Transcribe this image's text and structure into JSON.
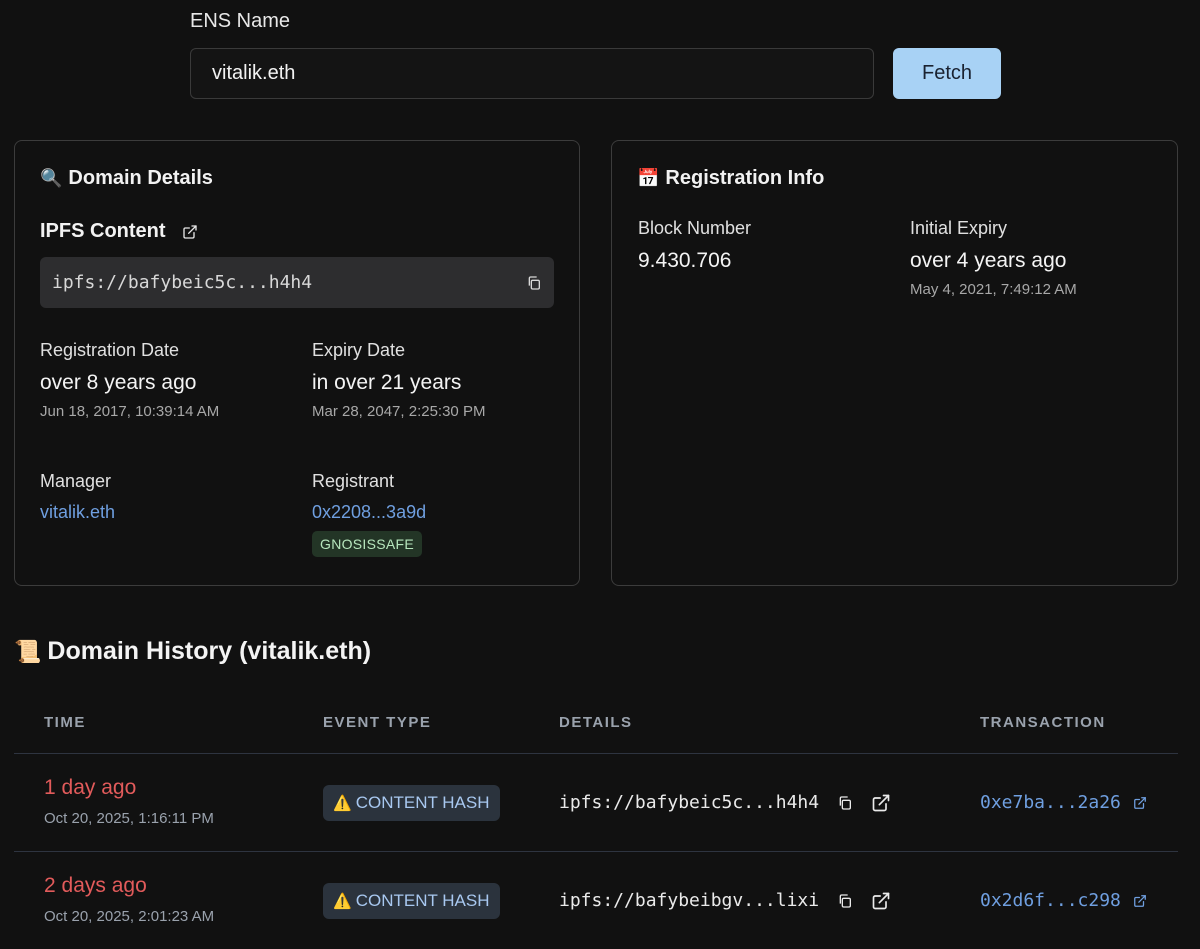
{
  "search": {
    "label": "ENS Name",
    "value": "vitalik.eth",
    "button_label": "Fetch"
  },
  "domain_details": {
    "emoji": "🔍",
    "title": "Domain Details",
    "ipfs_heading": "IPFS Content",
    "ipfs_value": "ipfs://bafybeic5c...h4h4",
    "registration": {
      "label": "Registration Date",
      "relative": "over 8 years ago",
      "absolute": "Jun 18, 2017, 10:39:14 AM"
    },
    "expiry": {
      "label": "Expiry Date",
      "relative": "in over 21 years",
      "absolute": "Mar 28, 2047, 2:25:30 PM"
    },
    "manager": {
      "label": "Manager",
      "value": "vitalik.eth"
    },
    "registrant": {
      "label": "Registrant",
      "value": "0x2208...3a9d",
      "badge": "GNOSISSAFE"
    }
  },
  "registration_info": {
    "emoji": "📅",
    "title": "Registration Info",
    "block": {
      "label": "Block Number",
      "value": "9.430.706"
    },
    "initial_expiry": {
      "label": "Initial Expiry",
      "relative": "over 4 years ago",
      "absolute": "May 4, 2021, 7:49:12 AM"
    }
  },
  "history": {
    "emoji": "📜",
    "title": "Domain History (vitalik.eth)",
    "columns": {
      "time": "TIME",
      "event_type": "EVENT TYPE",
      "details": "DETAILS",
      "transaction": "TRANSACTION"
    },
    "rows": [
      {
        "time_relative": "1 day ago",
        "time_absolute": "Oct 20, 2025, 1:16:11 PM",
        "event_icon": "⚠️",
        "event_type": "CONTENT HASH",
        "details": "ipfs://bafybeic5c...h4h4",
        "transaction": "0xe7ba...2a26"
      },
      {
        "time_relative": "2 days ago",
        "time_absolute": "Oct 20, 2025, 2:01:23 AM",
        "event_icon": "⚠️",
        "event_type": "CONTENT HASH",
        "details": "ipfs://bafybeibgv...lixi",
        "transaction": "0x2d6f...c298"
      }
    ]
  },
  "colors": {
    "background": "#111111",
    "accent_button": "#a8d2f5",
    "link": "#6f9fe0",
    "time_red": "#e25b5b",
    "badge_green_bg": "#233526",
    "event_badge_bg": "#2b333d"
  }
}
